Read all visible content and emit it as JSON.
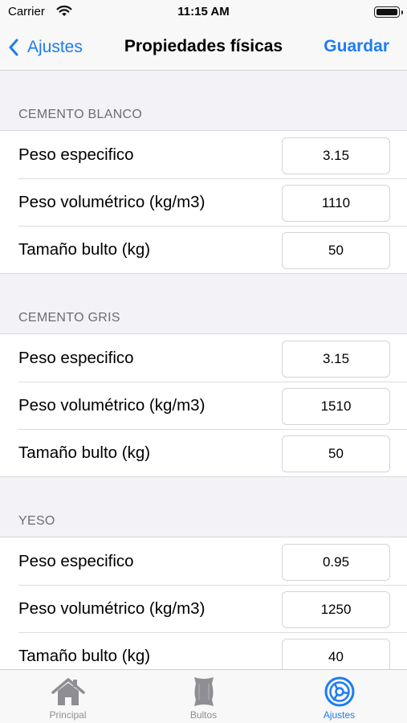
{
  "status_bar": {
    "carrier": "Carrier",
    "time": "11:15 AM"
  },
  "nav": {
    "back_label": "Ajustes",
    "title": "Propiedades físicas",
    "save_label": "Guardar"
  },
  "sections": [
    {
      "header": "CEMENTO BLANCO",
      "rows": [
        {
          "label": "Peso especifico",
          "value": "3.15"
        },
        {
          "label": "Peso volumétrico (kg/m3)",
          "value": "1110"
        },
        {
          "label": "Tamaño bulto (kg)",
          "value": "50"
        }
      ]
    },
    {
      "header": "CEMENTO GRIS",
      "rows": [
        {
          "label": "Peso especifico",
          "value": "3.15"
        },
        {
          "label": "Peso volumétrico (kg/m3)",
          "value": "1510"
        },
        {
          "label": "Tamaño bulto (kg)",
          "value": "50"
        }
      ]
    },
    {
      "header": "YESO",
      "rows": [
        {
          "label": "Peso especifico",
          "value": "0.95"
        },
        {
          "label": "Peso volumétrico (kg/m3)",
          "value": "1250"
        },
        {
          "label": "Tamaño bulto (kg)",
          "value": "40"
        }
      ]
    }
  ],
  "tab_bar": {
    "tabs": [
      {
        "label": "Principal",
        "icon": "house-icon",
        "active": false
      },
      {
        "label": "Bultos",
        "icon": "sack-icon",
        "active": false
      },
      {
        "label": "Ajustes",
        "icon": "settings-icon",
        "active": true
      }
    ]
  },
  "colors": {
    "accent": "#1d7cf2",
    "inactive": "#8e8e93",
    "background": "#f2f2f7"
  }
}
